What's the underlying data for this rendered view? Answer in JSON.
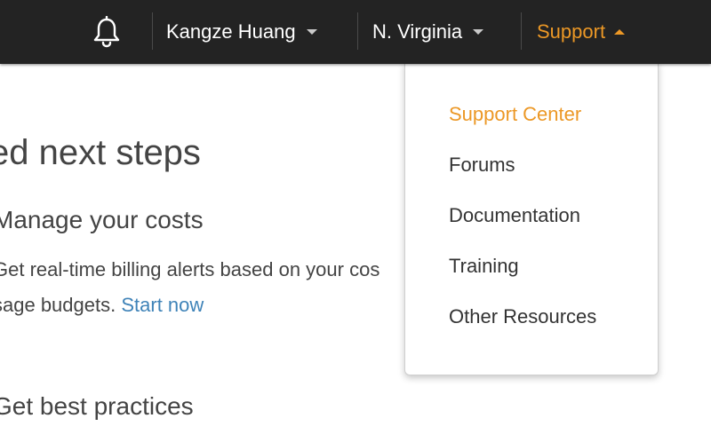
{
  "topbar": {
    "bell_icon": "bell-icon",
    "user_name": "Kangze Huang",
    "region": "N. Virginia",
    "support": "Support"
  },
  "colors": {
    "accent": "#ec9826",
    "link": "#3f83b8",
    "topbar_bg": "#232323"
  },
  "main": {
    "heading": "ed next steps",
    "section1": {
      "title": "Manage your costs",
      "text_line1": "Get real-time billing alerts based on your cos",
      "text_line2": "sage budgets.",
      "link": "Start now"
    },
    "section2": {
      "title": "Get best practices"
    }
  },
  "support_menu": {
    "items": [
      {
        "label": "Support Center"
      },
      {
        "label": "Forums"
      },
      {
        "label": "Documentation"
      },
      {
        "label": "Training"
      },
      {
        "label": "Other Resources"
      }
    ]
  }
}
